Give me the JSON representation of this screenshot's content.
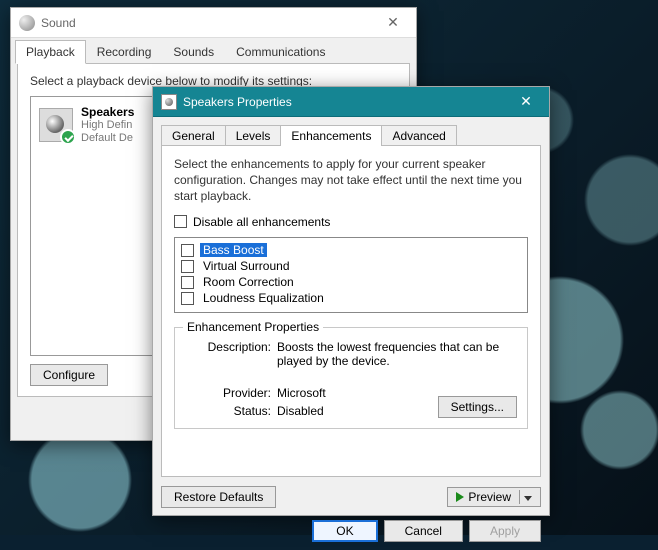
{
  "sound": {
    "title": "Sound",
    "tabs": [
      "Playback",
      "Recording",
      "Sounds",
      "Communications"
    ],
    "activeTab": 0,
    "instruction": "Select a playback device below to modify its settings:",
    "device": {
      "name": "Speakers",
      "line1": "High Defin",
      "line2": "Default De"
    },
    "configure": "Configure"
  },
  "props": {
    "title": "Speakers Properties",
    "tabs": [
      "General",
      "Levels",
      "Enhancements",
      "Advanced"
    ],
    "activeTab": 2,
    "description": "Select the enhancements to apply for your current speaker configuration. Changes may not take effect until the next time you start playback.",
    "disableAll": "Disable all enhancements",
    "items": [
      "Bass Boost",
      "Virtual Surround",
      "Room Correction",
      "Loudness Equalization"
    ],
    "selectedIndex": 0,
    "group": {
      "legend": "Enhancement Properties",
      "descriptionLabel": "Description:",
      "descriptionValue": "Boosts the lowest frequencies that can be played by the device.",
      "providerLabel": "Provider:",
      "providerValue": "Microsoft",
      "statusLabel": "Status:",
      "statusValue": "Disabled",
      "settings": "Settings..."
    },
    "restore": "Restore Defaults",
    "preview": "Preview",
    "ok": "OK",
    "cancel": "Cancel",
    "apply": "Apply"
  }
}
